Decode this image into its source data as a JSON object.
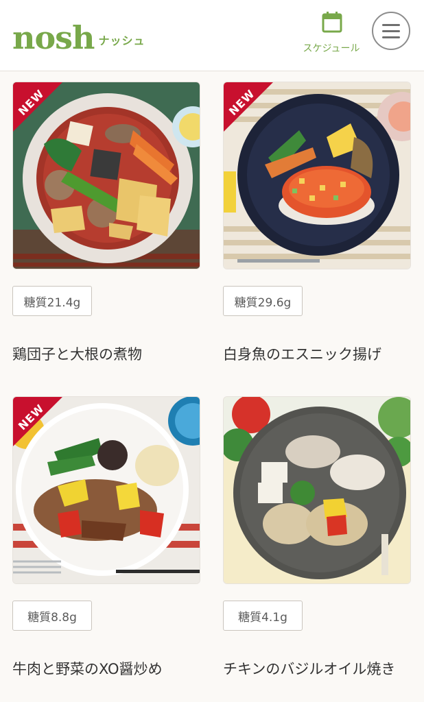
{
  "header": {
    "logo_main": "nosh",
    "logo_sub": "ナッシュ",
    "schedule_label": "スケジュール",
    "menu_icon": "hamburger-menu-icon",
    "schedule_icon": "calendar-icon",
    "accent_color": "#78a84a"
  },
  "products": [
    {
      "badge_new": "NEW",
      "carb": "糖質21.4g",
      "name": "鶏団子と大根の煮物"
    },
    {
      "badge_new": "NEW",
      "carb": "糖質29.6g",
      "name": "白身魚のエスニック揚げ"
    },
    {
      "badge_new": "NEW",
      "carb": "糖質8.8g",
      "name": "牛肉と野菜のXO醤炒め"
    },
    {
      "badge_new": "",
      "carb": "糖質4.1g",
      "name": "チキンのバジルオイル焼き"
    }
  ],
  "colors": {
    "new_ribbon": "#c8102e",
    "text": "#333333"
  }
}
